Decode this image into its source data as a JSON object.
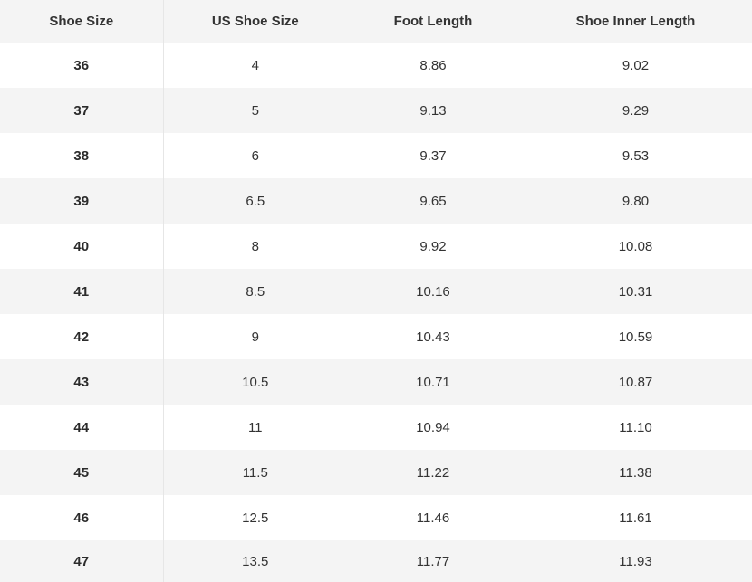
{
  "table": {
    "headers": [
      "Shoe Size",
      "US Shoe Size",
      "Foot Length",
      "Shoe Inner Length"
    ],
    "rows": [
      [
        "36",
        "4",
        "8.86",
        "9.02"
      ],
      [
        "37",
        "5",
        "9.13",
        "9.29"
      ],
      [
        "38",
        "6",
        "9.37",
        "9.53"
      ],
      [
        "39",
        "6.5",
        "9.65",
        "9.80"
      ],
      [
        "40",
        "8",
        "9.92",
        "10.08"
      ],
      [
        "41",
        "8.5",
        "10.16",
        "10.31"
      ],
      [
        "42",
        "9",
        "10.43",
        "10.59"
      ],
      [
        "43",
        "10.5",
        "10.71",
        "10.87"
      ],
      [
        "44",
        "11",
        "10.94",
        "11.10"
      ],
      [
        "45",
        "11.5",
        "11.22",
        "11.38"
      ],
      [
        "46",
        "12.5",
        "11.46",
        "11.61"
      ],
      [
        "47",
        "13.5",
        "11.77",
        "11.93"
      ]
    ]
  }
}
